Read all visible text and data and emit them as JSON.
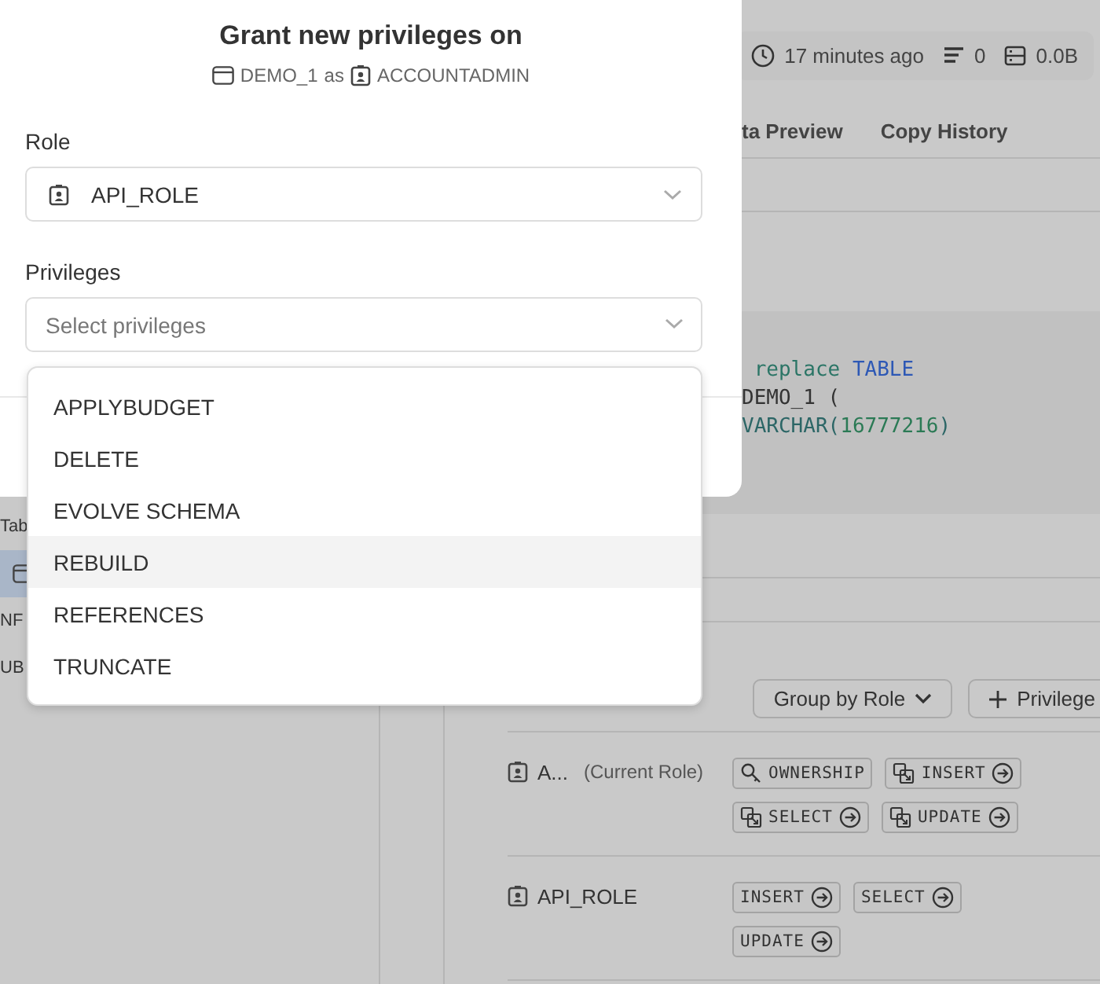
{
  "background": {
    "stats": [
      {
        "kind": "time",
        "text": "17 minutes ago"
      },
      {
        "kind": "rows",
        "text": "0"
      },
      {
        "kind": "size",
        "text": "0.0B"
      }
    ],
    "tabs": [
      "ta Preview",
      "Copy History"
    ],
    "code": [
      [
        {
          "text": " replace ",
          "kind": "keyword"
        },
        {
          "text": "TABLE",
          "kind": "type"
        }
      ],
      [
        {
          "text": "DEMO_1 (",
          "kind": "plain"
        }
      ],
      [
        {
          "text": "VARCHAR(",
          "kind": "func"
        },
        {
          "text": "16777216",
          "kind": "number"
        },
        {
          "text": ")",
          "kind": "func"
        }
      ]
    ],
    "sidebar": [
      {
        "kind": "text",
        "label": "Tab",
        "selected": false
      },
      {
        "kind": "icon",
        "selected": true
      },
      {
        "kind": "text",
        "label": "NF",
        "selected": false
      },
      {
        "kind": "text",
        "label": "UB",
        "selected": false
      }
    ],
    "privileges": {
      "group_button": "Group by Role",
      "add_button": "Privilege",
      "roles": [
        {
          "name": "A...",
          "note": "(Current Role)",
          "grants": [
            {
              "label": "OWNERSHIP",
              "kind": "owner"
            },
            {
              "label": "INSERT",
              "kind": "inherited"
            },
            {
              "label": "SELECT",
              "kind": "inherited"
            },
            {
              "label": "UPDATE",
              "kind": "inherited"
            }
          ]
        },
        {
          "name": "API_ROLE",
          "grants": [
            {
              "label": "INSERT",
              "kind": "direct"
            },
            {
              "label": "SELECT",
              "kind": "direct"
            },
            {
              "label": "UPDATE",
              "kind": "direct"
            }
          ]
        }
      ]
    }
  },
  "dialog": {
    "title": "Grant new privileges on",
    "object": "DEMO_1",
    "connector": "as",
    "current_role": "ACCOUNTADMIN",
    "fields": [
      {
        "label": "Role",
        "kind": "role",
        "value": "API_ROLE"
      },
      {
        "label": "Privileges",
        "kind": "multi",
        "placeholder": "Select privileges"
      }
    ]
  },
  "privilege_menu": {
    "items": [
      {
        "label": "APPLYBUDGET",
        "highlighted": false
      },
      {
        "label": "DELETE",
        "highlighted": false
      },
      {
        "label": "EVOLVE SCHEMA",
        "highlighted": false
      },
      {
        "label": "REBUILD",
        "highlighted": true
      },
      {
        "label": "REFERENCES",
        "highlighted": false
      },
      {
        "label": "TRUNCATE",
        "highlighted": false
      }
    ]
  }
}
